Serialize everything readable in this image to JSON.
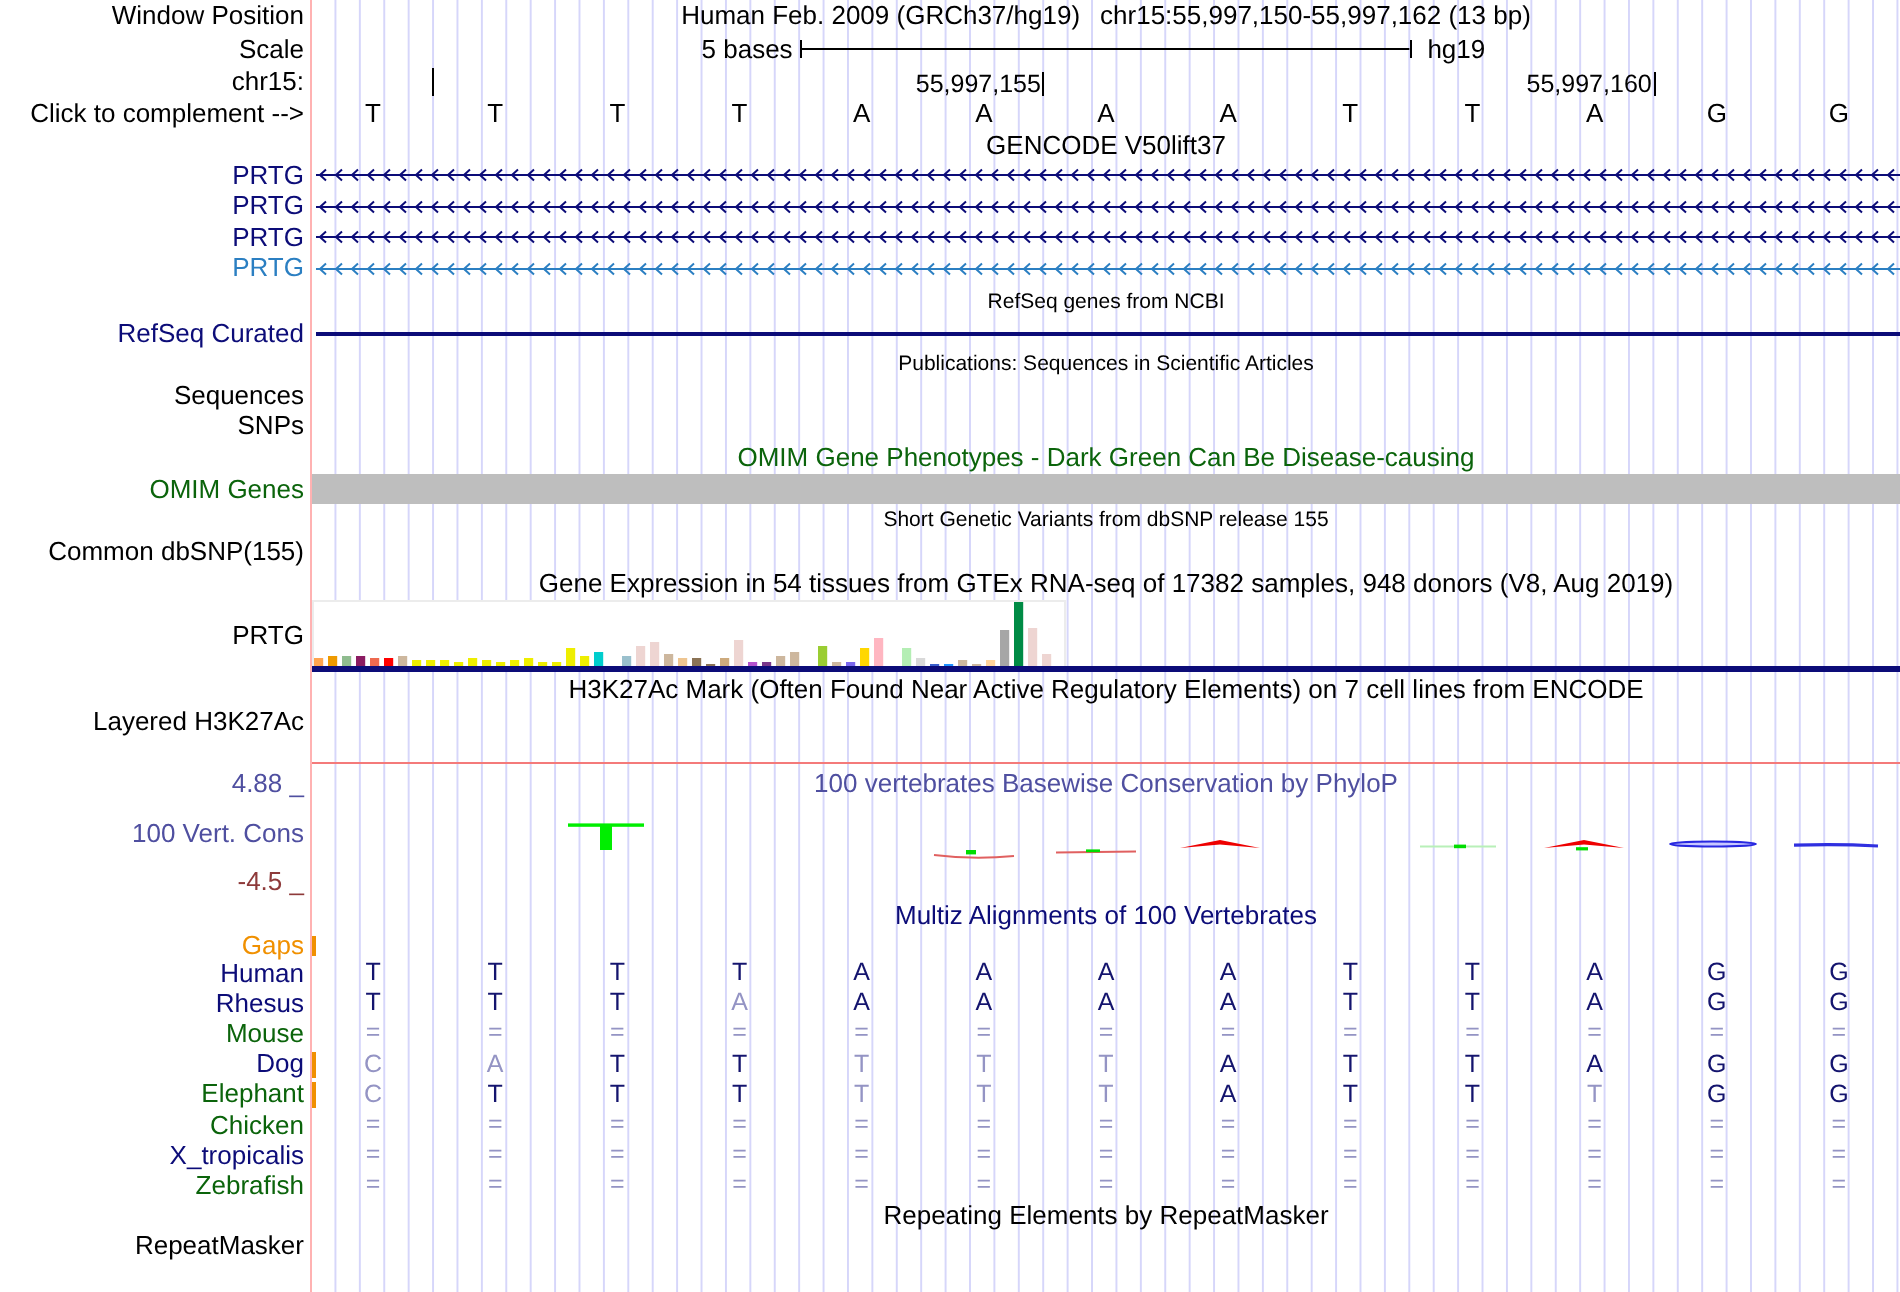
{
  "position": {
    "label": "Window Position",
    "assembly": "Human Feb. 2009 (GRCh37/hg19)",
    "region": "chr15:55,997,150-55,997,162 (13 bp)"
  },
  "scale": {
    "label": "Scale",
    "span": "5 bases",
    "assembly": "hg19"
  },
  "ruler": {
    "label": "chr15:",
    "ticks": [
      {
        "kind": "minor"
      },
      {
        "kind": "major",
        "label": "55,997,155"
      },
      {
        "kind": "major",
        "label": "55,997,160"
      }
    ]
  },
  "sequence": {
    "label": "Click to complement -->",
    "bases": [
      "T",
      "T",
      "T",
      "T",
      "A",
      "A",
      "A",
      "A",
      "T",
      "T",
      "A",
      "G",
      "G"
    ]
  },
  "tracks": [
    {
      "kind": "genes",
      "title": "GENCODE V50lift37",
      "transcripts": [
        {
          "label": "PRTG",
          "color": "#0c0c78"
        },
        {
          "label": "PRTG",
          "color": "#0c0c78"
        },
        {
          "label": "PRTG",
          "color": "#0c0c78"
        },
        {
          "label": "PRTG",
          "color": "#2b7fc2"
        }
      ]
    },
    {
      "kind": "line",
      "title": "RefSeq genes from NCBI",
      "labels": [
        "RefSeq Curated"
      ],
      "color": "#0c0c78"
    },
    {
      "kind": "notes",
      "title": "Publications: Sequences in Scientific Articles",
      "labels": [
        "Sequences",
        "SNPs"
      ]
    },
    {
      "kind": "bar",
      "title": "OMIM Gene Phenotypes - Dark Green Can Be Disease-causing",
      "labels": [
        "OMIM Genes"
      ],
      "color": "#0b640b"
    },
    {
      "kind": "notes",
      "title": "Short Genetic Variants from dbSNP release 155",
      "labels": [
        "Common dbSNP(155)"
      ]
    },
    {
      "kind": "expression",
      "title": "Gene Expression in 54 tissues from GTEx RNA-seq of 17382 samples, 948 donors (V8, Aug 2019)",
      "labels": [
        "PRTG"
      ]
    },
    {
      "kind": "signal",
      "title": "H3K27Ac Mark (Often Found Near Active Regulatory Elements) on 7 cell lines from ENCODE",
      "labels": [
        "Layered H3K27Ac"
      ]
    },
    {
      "kind": "conservation",
      "title": "100 vertebrates Basewise Conservation by PhyloP",
      "labels": [
        "4.88 _",
        "100 Vert. Cons",
        "-4.5 _"
      ],
      "color": "#4f4fa0"
    },
    {
      "kind": "alignment",
      "title": "Multiz Alignments of 100 Vertebrates",
      "color": "#0c0c78",
      "gaps_label": "Gaps",
      "species": [
        {
          "name": "Human",
          "color": "#0c0c78",
          "gap": false,
          "cells": [
            {
              "base": "T",
              "match": true
            },
            {
              "base": "T",
              "match": true
            },
            {
              "base": "T",
              "match": true
            },
            {
              "base": "T",
              "match": true
            },
            {
              "base": "A",
              "match": true
            },
            {
              "base": "A",
              "match": true
            },
            {
              "base": "A",
              "match": true
            },
            {
              "base": "A",
              "match": true
            },
            {
              "base": "T",
              "match": true
            },
            {
              "base": "T",
              "match": true
            },
            {
              "base": "A",
              "match": true
            },
            {
              "base": "G",
              "match": true
            },
            {
              "base": "G",
              "match": true
            }
          ]
        },
        {
          "name": "Rhesus",
          "color": "#0c0c78",
          "gap": false,
          "cells": [
            {
              "base": "T",
              "match": true
            },
            {
              "base": "T",
              "match": true
            },
            {
              "base": "T",
              "match": true
            },
            {
              "base": "A",
              "match": false
            },
            {
              "base": "A",
              "match": true
            },
            {
              "base": "A",
              "match": true
            },
            {
              "base": "A",
              "match": true
            },
            {
              "base": "A",
              "match": true
            },
            {
              "base": "T",
              "match": true
            },
            {
              "base": "T",
              "match": true
            },
            {
              "base": "A",
              "match": true
            },
            {
              "base": "G",
              "match": true
            },
            {
              "base": "G",
              "match": true
            }
          ]
        },
        {
          "name": "Mouse",
          "color": "#0b640b",
          "gap": false,
          "cells": [
            {
              "base": "=",
              "match": false
            },
            {
              "base": "=",
              "match": false
            },
            {
              "base": "=",
              "match": false
            },
            {
              "base": "=",
              "match": false
            },
            {
              "base": "=",
              "match": false
            },
            {
              "base": "=",
              "match": false
            },
            {
              "base": "=",
              "match": false
            },
            {
              "base": "=",
              "match": false
            },
            {
              "base": "=",
              "match": false
            },
            {
              "base": "=",
              "match": false
            },
            {
              "base": "=",
              "match": false
            },
            {
              "base": "=",
              "match": false
            },
            {
              "base": "=",
              "match": false
            }
          ]
        },
        {
          "name": "Dog",
          "color": "#0c0c78",
          "gap": true,
          "cells": [
            {
              "base": "C",
              "match": false
            },
            {
              "base": "A",
              "match": false
            },
            {
              "base": "T",
              "match": true
            },
            {
              "base": "T",
              "match": true
            },
            {
              "base": "T",
              "match": false
            },
            {
              "base": "T",
              "match": false
            },
            {
              "base": "T",
              "match": false
            },
            {
              "base": "A",
              "match": true
            },
            {
              "base": "T",
              "match": true
            },
            {
              "base": "T",
              "match": true
            },
            {
              "base": "A",
              "match": true
            },
            {
              "base": "G",
              "match": true
            },
            {
              "base": "G",
              "match": true
            }
          ]
        },
        {
          "name": "Elephant",
          "color": "#0b640b",
          "gap": true,
          "cells": [
            {
              "base": "C",
              "match": false
            },
            {
              "base": "T",
              "match": true
            },
            {
              "base": "T",
              "match": true
            },
            {
              "base": "T",
              "match": true
            },
            {
              "base": "T",
              "match": false
            },
            {
              "base": "T",
              "match": false
            },
            {
              "base": "T",
              "match": false
            },
            {
              "base": "A",
              "match": true
            },
            {
              "base": "T",
              "match": true
            },
            {
              "base": "T",
              "match": true
            },
            {
              "base": "T",
              "match": false
            },
            {
              "base": "G",
              "match": true
            },
            {
              "base": "G",
              "match": true
            }
          ]
        },
        {
          "name": "Chicken",
          "color": "#0b640b",
          "gap": false,
          "cells": [
            {
              "base": "=",
              "match": false
            },
            {
              "base": "=",
              "match": false
            },
            {
              "base": "=",
              "match": false
            },
            {
              "base": "=",
              "match": false
            },
            {
              "base": "=",
              "match": false
            },
            {
              "base": "=",
              "match": false
            },
            {
              "base": "=",
              "match": false
            },
            {
              "base": "=",
              "match": false
            },
            {
              "base": "=",
              "match": false
            },
            {
              "base": "=",
              "match": false
            },
            {
              "base": "=",
              "match": false
            },
            {
              "base": "=",
              "match": false
            },
            {
              "base": "=",
              "match": false
            }
          ]
        },
        {
          "name": "X_tropicalis",
          "color": "#0c0c78",
          "gap": false,
          "cells": [
            {
              "base": "=",
              "match": false
            },
            {
              "base": "=",
              "match": false
            },
            {
              "base": "=",
              "match": false
            },
            {
              "base": "=",
              "match": false
            },
            {
              "base": "=",
              "match": false
            },
            {
              "base": "=",
              "match": false
            },
            {
              "base": "=",
              "match": false
            },
            {
              "base": "=",
              "match": false
            },
            {
              "base": "=",
              "match": false
            },
            {
              "base": "=",
              "match": false
            },
            {
              "base": "=",
              "match": false
            },
            {
              "base": "=",
              "match": false
            },
            {
              "base": "=",
              "match": false
            }
          ]
        },
        {
          "name": "Zebrafish",
          "color": "#0b640b",
          "gap": false,
          "cells": [
            {
              "base": "=",
              "match": false
            },
            {
              "base": "=",
              "match": false
            },
            {
              "base": "=",
              "match": false
            },
            {
              "base": "=",
              "match": false
            },
            {
              "base": "=",
              "match": false
            },
            {
              "base": "=",
              "match": false
            },
            {
              "base": "=",
              "match": false
            },
            {
              "base": "=",
              "match": false
            },
            {
              "base": "=",
              "match": false
            },
            {
              "base": "=",
              "match": false
            },
            {
              "base": "=",
              "match": false
            },
            {
              "base": "=",
              "match": false
            },
            {
              "base": "=",
              "match": false
            }
          ]
        }
      ]
    },
    {
      "kind": "plain",
      "title": "Repeating Elements by RepeatMasker",
      "labels": [
        "RepeatMasker"
      ]
    }
  ]
}
